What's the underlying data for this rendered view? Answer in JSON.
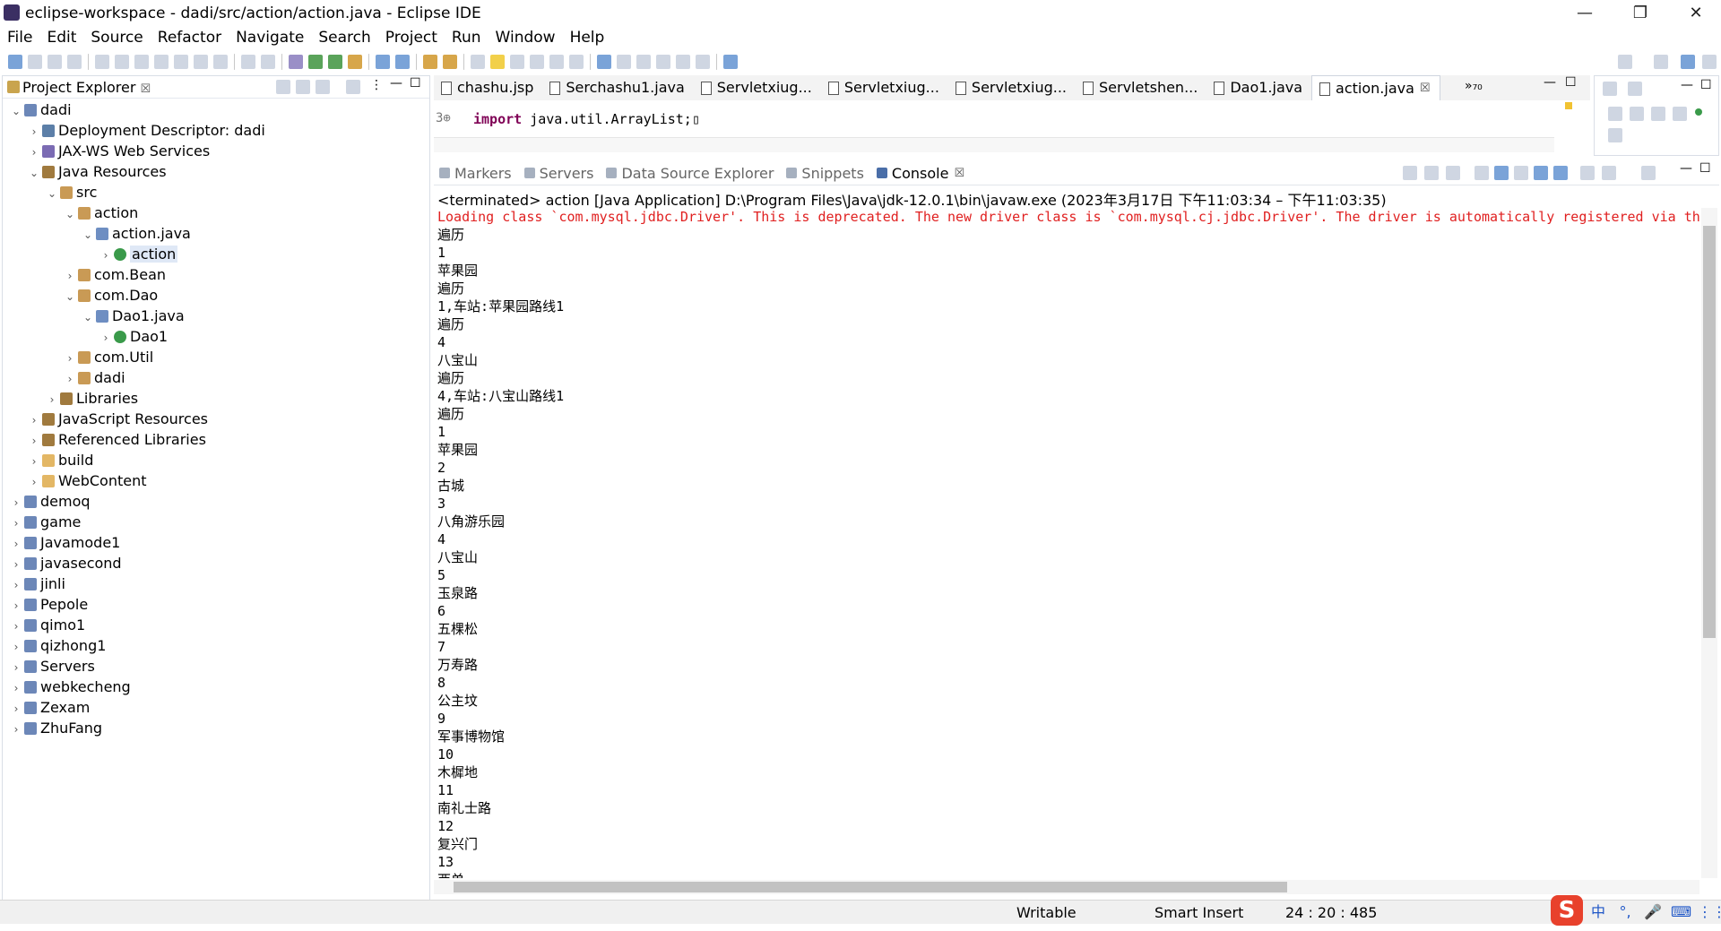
{
  "window": {
    "title": "eclipse-workspace - dadi/src/action/action.java - Eclipse IDE",
    "minimize": "—",
    "restore": "❐",
    "close": "✕"
  },
  "menu": [
    "File",
    "Edit",
    "Source",
    "Refactor",
    "Navigate",
    "Search",
    "Project",
    "Run",
    "Window",
    "Help"
  ],
  "project_explorer": {
    "title": "Project Explorer",
    "close": "☒",
    "tree": [
      {
        "label": "dadi",
        "arrow": "⌄",
        "depth": 0,
        "icon": "proj"
      },
      {
        "label": "Deployment Descriptor: dadi",
        "arrow": "›",
        "depth": 1,
        "icon": "desc"
      },
      {
        "label": "JAX-WS Web Services",
        "arrow": "›",
        "depth": 1,
        "icon": "ws"
      },
      {
        "label": "Java Resources",
        "arrow": "⌄",
        "depth": 1,
        "icon": "lib"
      },
      {
        "label": "src",
        "arrow": "⌄",
        "depth": 2,
        "icon": "pkg"
      },
      {
        "label": "action",
        "arrow": "⌄",
        "depth": 3,
        "icon": "pkg"
      },
      {
        "label": "action.java",
        "arrow": "⌄",
        "depth": 4,
        "icon": "java"
      },
      {
        "label": "action",
        "arrow": "›",
        "depth": 5,
        "icon": "class",
        "selected": true
      },
      {
        "label": "com.Bean",
        "arrow": "›",
        "depth": 3,
        "icon": "pkg"
      },
      {
        "label": "com.Dao",
        "arrow": "⌄",
        "depth": 3,
        "icon": "pkg"
      },
      {
        "label": "Dao1.java",
        "arrow": "⌄",
        "depth": 4,
        "icon": "java"
      },
      {
        "label": "Dao1",
        "arrow": "›",
        "depth": 5,
        "icon": "class"
      },
      {
        "label": "com.Util",
        "arrow": "›",
        "depth": 3,
        "icon": "pkg"
      },
      {
        "label": "dadi",
        "arrow": "›",
        "depth": 3,
        "icon": "pkg"
      },
      {
        "label": "Libraries",
        "arrow": "›",
        "depth": 2,
        "icon": "lib"
      },
      {
        "label": "JavaScript Resources",
        "arrow": "›",
        "depth": 1,
        "icon": "lib"
      },
      {
        "label": "Referenced Libraries",
        "arrow": "›",
        "depth": 1,
        "icon": "lib"
      },
      {
        "label": "build",
        "arrow": "›",
        "depth": 1,
        "icon": "folder"
      },
      {
        "label": "WebContent",
        "arrow": "›",
        "depth": 1,
        "icon": "folder"
      },
      {
        "label": "demoq",
        "arrow": "›",
        "depth": 0,
        "icon": "proj"
      },
      {
        "label": "game",
        "arrow": "›",
        "depth": 0,
        "icon": "proj"
      },
      {
        "label": "Javamode1",
        "arrow": "›",
        "depth": 0,
        "icon": "proj"
      },
      {
        "label": "javasecond",
        "arrow": "›",
        "depth": 0,
        "icon": "proj"
      },
      {
        "label": "jinli",
        "arrow": "›",
        "depth": 0,
        "icon": "proj"
      },
      {
        "label": "Pepole",
        "arrow": "›",
        "depth": 0,
        "icon": "proj"
      },
      {
        "label": "qimo1",
        "arrow": "›",
        "depth": 0,
        "icon": "proj"
      },
      {
        "label": "qizhong1",
        "arrow": "›",
        "depth": 0,
        "icon": "proj"
      },
      {
        "label": "Servers",
        "arrow": "›",
        "depth": 0,
        "icon": "proj"
      },
      {
        "label": "webkecheng",
        "arrow": "›",
        "depth": 0,
        "icon": "proj"
      },
      {
        "label": "Zexam",
        "arrow": "›",
        "depth": 0,
        "icon": "proj"
      },
      {
        "label": "ZhuFang",
        "arrow": "›",
        "depth": 0,
        "icon": "proj"
      }
    ]
  },
  "editor": {
    "tabs": [
      {
        "label": "chashu.jsp",
        "active": false
      },
      {
        "label": "Serchashu1.java",
        "active": false
      },
      {
        "label": "Servletxiug...",
        "active": false
      },
      {
        "label": "Servletxiug...",
        "active": false
      },
      {
        "label": "Servletxiug...",
        "active": false
      },
      {
        "label": "Servletshen...",
        "active": false
      },
      {
        "label": "Dao1.java",
        "active": false
      },
      {
        "label": "action.java",
        "active": true
      }
    ],
    "overflow_tabs": "»₇₀",
    "line_number": "3⊕",
    "code_keyword": "import",
    "code_rest": " java.util.ArrayList;▯"
  },
  "console": {
    "tabs": [
      {
        "label": "Markers",
        "active": false
      },
      {
        "label": "Servers",
        "active": false
      },
      {
        "label": "Data Source Explorer",
        "active": false
      },
      {
        "label": "Snippets",
        "active": false
      },
      {
        "label": "Console",
        "active": true
      }
    ],
    "status": "<terminated> action [Java Application] D:\\Program Files\\Java\\jdk-12.0.1\\bin\\javaw.exe  (2023年3月17日 下午11:03:34 – 下午11:03:35)",
    "error": "Loading class `com.mysql.jdbc.Driver'. This is deprecated. The new driver class is `com.mysql.cj.jdbc.Driver'. The driver is automatically registered via the",
    "output": [
      "遍历",
      "1",
      "苹果园",
      "遍历",
      "1,车站:苹果园路线1",
      "遍历",
      "4",
      "八宝山",
      "遍历",
      "4,车站:八宝山路线1",
      "遍历",
      "1",
      "苹果园",
      "2",
      "古城",
      "3",
      "八角游乐园",
      "4",
      "八宝山",
      "5",
      "玉泉路",
      "6",
      "五棵松",
      "7",
      "万寿路",
      "8",
      "公主坟",
      "9",
      "军事博物馆",
      "10",
      "木樨地",
      "11",
      "南礼士路",
      "12",
      "复兴门",
      "13",
      "西单"
    ]
  },
  "statusbar": {
    "writable": "Writable",
    "insert_mode": "Smart Insert",
    "position": "24 : 20 : 485"
  },
  "ime": {
    "logo": "S",
    "lang": "中",
    "punct": "°,",
    "mic": "🎤",
    "keyboard": "⌨",
    "skin": "⋮⋮"
  }
}
